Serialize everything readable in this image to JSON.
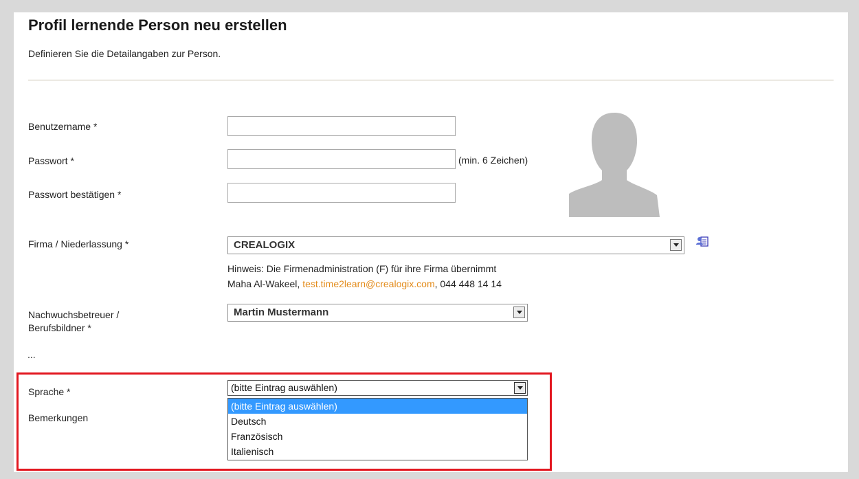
{
  "page": {
    "title": "Profil lernende Person neu erstellen",
    "subtitle": "Definieren Sie die Detailangaben zur Person."
  },
  "form": {
    "username": {
      "label": "Benutzername *",
      "value": ""
    },
    "password": {
      "label": "Passwort *",
      "value": "",
      "hint": "(min. 6 Zeichen)"
    },
    "password_confirm": {
      "label": "Passwort bestätigen *",
      "value": ""
    },
    "company": {
      "label": "Firma / Niederlassung *",
      "selected": "CREALOGIX",
      "hint_line1": "Hinweis: Die Firmenadministration (F) für ihre Firma übernimmt",
      "hint_admin": "Maha Al-Wakeel, ",
      "hint_email": "test.time2learn@crealogix.com",
      "hint_phone": ", 044 448 14 14"
    },
    "supervisor": {
      "label_line1": "Nachwuchsbetreuer /",
      "label_line2": "Berufsbildner *",
      "selected": "Martin Mustermann"
    },
    "ellipsis": "...",
    "language": {
      "label": "Sprache *",
      "selected": "(bitte Eintrag auswählen)",
      "options": [
        "(bitte Eintrag auswählen)",
        "Deutsch",
        "Französisch",
        "Italienisch"
      ]
    },
    "remarks": {
      "label": "Bemerkungen"
    }
  },
  "icons": {
    "avatar": "person-silhouette-icon",
    "address_book": "address-book-icon",
    "dropdown": "chevron-down-icon"
  },
  "colors": {
    "highlight_border": "#e2161f",
    "link": "#e38c1c",
    "selected_option": "#3399ff"
  }
}
